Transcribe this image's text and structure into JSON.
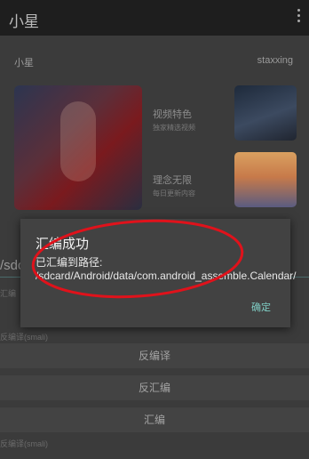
{
  "app": {
    "title": "小星"
  },
  "profile": {
    "left_name": "小星",
    "right_name": "staxxing"
  },
  "features": [
    {
      "title": "视频特色",
      "sub": "独家精选视频"
    },
    {
      "title": "理念无限",
      "sub": "每日更新内容"
    }
  ],
  "path_prefix": "/sdc",
  "labels": {
    "l1": "汇编",
    "l2": "反编译(smali)",
    "l3": "反编译(smali)"
  },
  "buttons": {
    "decompile": "反编译",
    "disassemble": "反汇编",
    "assemble": "汇编"
  },
  "dialog": {
    "title": "汇编成功",
    "message": "已汇编到路径: /sdcard/Android/data/com.android_assemble.Calendar/",
    "ok_label": "确定"
  },
  "colors": {
    "accent": "#7fcdc4",
    "annotation": "#e0121b"
  }
}
